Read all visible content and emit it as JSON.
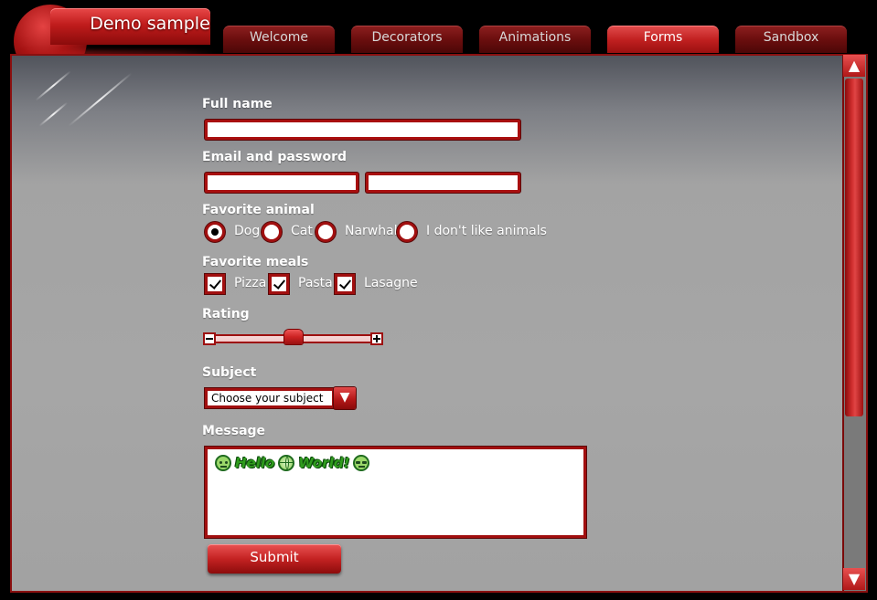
{
  "app": {
    "title": "Demo sample"
  },
  "tabs": [
    {
      "label": "Welcome",
      "active": false
    },
    {
      "label": "Decorators",
      "active": false
    },
    {
      "label": "Animations",
      "active": false
    },
    {
      "label": "Forms",
      "active": true
    },
    {
      "label": "Sandbox",
      "active": false
    }
  ],
  "form": {
    "full_name": {
      "label": "Full name",
      "value": ""
    },
    "credentials": {
      "label": "Email and password",
      "email_value": "",
      "password_value": ""
    },
    "animal": {
      "label": "Favorite animal",
      "options": [
        "Dog",
        "Cat",
        "Narwhal",
        "I don't like animals"
      ],
      "selected": "Dog"
    },
    "meals": {
      "label": "Favorite meals",
      "options": [
        "Pizza",
        "Pasta",
        "Lasagne"
      ],
      "checked": [
        "Pizza",
        "Pasta",
        "Lasagne"
      ]
    },
    "rating": {
      "label": "Rating",
      "value_fraction": 0.5
    },
    "subject": {
      "label": "Subject",
      "selected": "Choose your subject"
    },
    "message": {
      "label": "Message",
      "words": [
        "Hello",
        "World!"
      ]
    },
    "submit_label": "Submit"
  },
  "icons": {
    "emoji_smile": "smiley-icon",
    "globe": "globe-icon",
    "emoji_cool": "cool-face-icon",
    "dropdown": "chevron-down-icon",
    "scroll_up": "arrow-up-icon",
    "scroll_down": "arrow-down-icon"
  },
  "colors": {
    "accent": "#c02020",
    "accent_dark": "#8a0b0b",
    "panel_bg": "#a5a5a5",
    "message_text": "#2f9c1d"
  }
}
